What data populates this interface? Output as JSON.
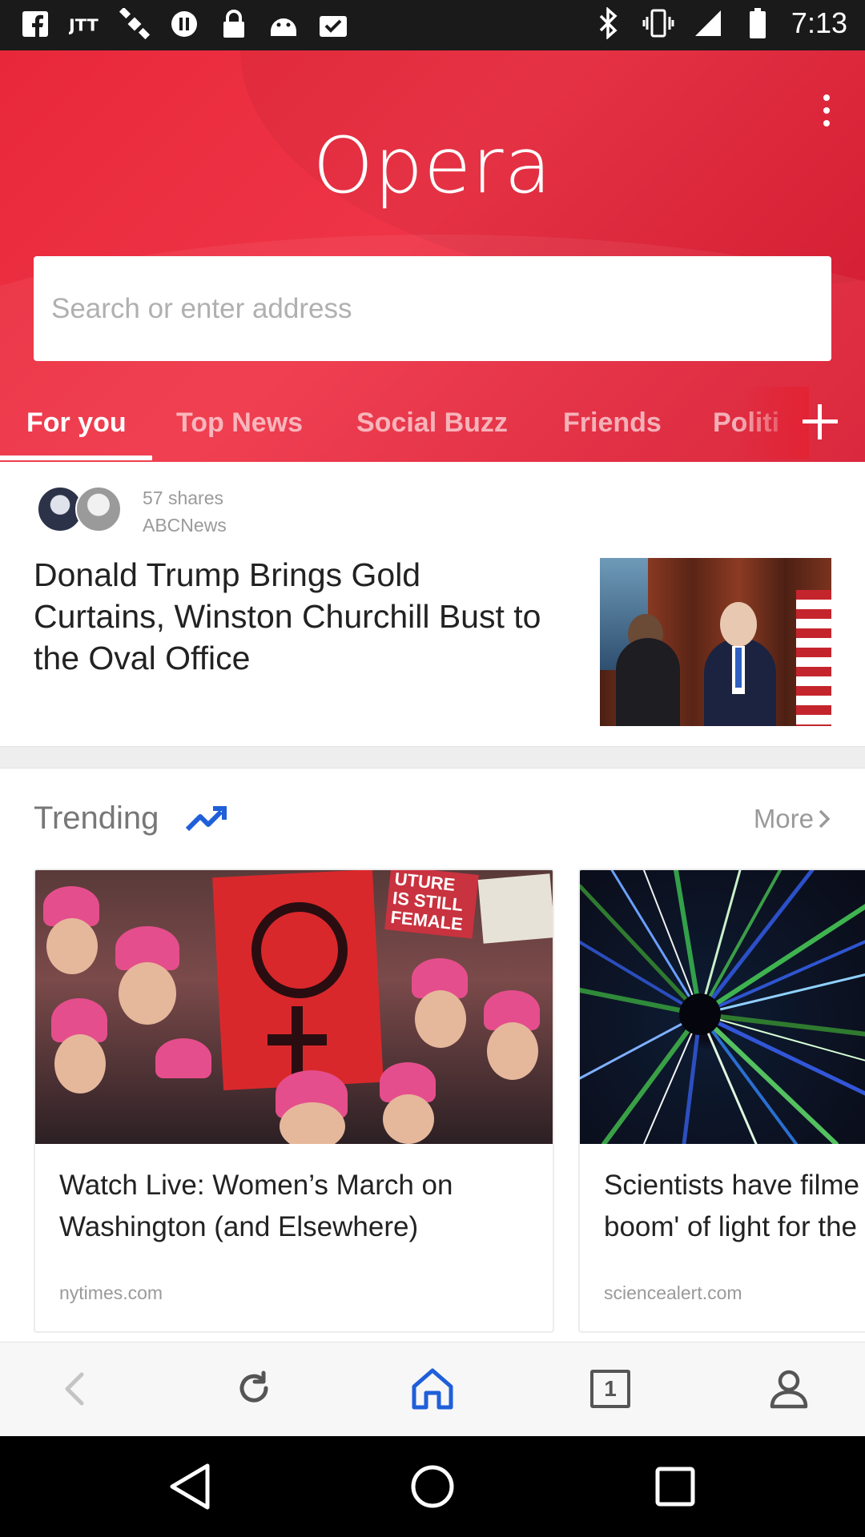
{
  "status_bar": {
    "time": "7:13",
    "left_icons": [
      "facebook-icon",
      "jtt-icon",
      "satellite-icon",
      "pause-icon",
      "lock-icon",
      "android-icon",
      "clipboard-check-icon"
    ],
    "right_icons": [
      "bluetooth-icon",
      "vibrate-icon",
      "signal-icon",
      "battery-icon"
    ]
  },
  "header": {
    "logo": "Opera",
    "menu_icon": "more-vert-icon",
    "background_color": "#e8283a"
  },
  "search": {
    "placeholder": "Search or enter address",
    "value": ""
  },
  "tabs": {
    "items": [
      {
        "label": "For you",
        "active": true
      },
      {
        "label": "Top News",
        "active": false
      },
      {
        "label": "Social Buzz",
        "active": false
      },
      {
        "label": "Friends",
        "active": false
      },
      {
        "label": "Politi",
        "active": false
      }
    ],
    "add_icon": "plus-icon"
  },
  "featured_article": {
    "shares": "57 shares",
    "source": "ABCNews",
    "headline_lines": [
      "Donald Trump Brings Gold",
      "Curtains, Winston Churchill Bust to",
      "the Oval Office"
    ]
  },
  "trending": {
    "title": "Trending",
    "icon": "trending-up-icon",
    "more_label": "More",
    "accent_color": "#1f5fd9",
    "cards": [
      {
        "title_lines": [
          "Watch Live: Women’s March on",
          "Washington (and Elsewhere)"
        ],
        "source": "nytimes.com",
        "sign_text_lines": [
          "IS STILL",
          "FEMALE"
        ],
        "sign_fragment": "UTURE"
      },
      {
        "title_lines": [
          "Scientists have filme",
          "boom' of light for the"
        ],
        "source": "sciencealert.com"
      }
    ]
  },
  "bottom_nav": {
    "items": [
      "back-icon",
      "refresh-icon",
      "home-icon",
      "tabs-icon",
      "profile-icon"
    ],
    "tab_count": "1",
    "active_color": "#1f5fd9"
  },
  "system_nav": {
    "items": [
      "back-triangle-icon",
      "home-circle-icon",
      "recents-square-icon"
    ]
  }
}
